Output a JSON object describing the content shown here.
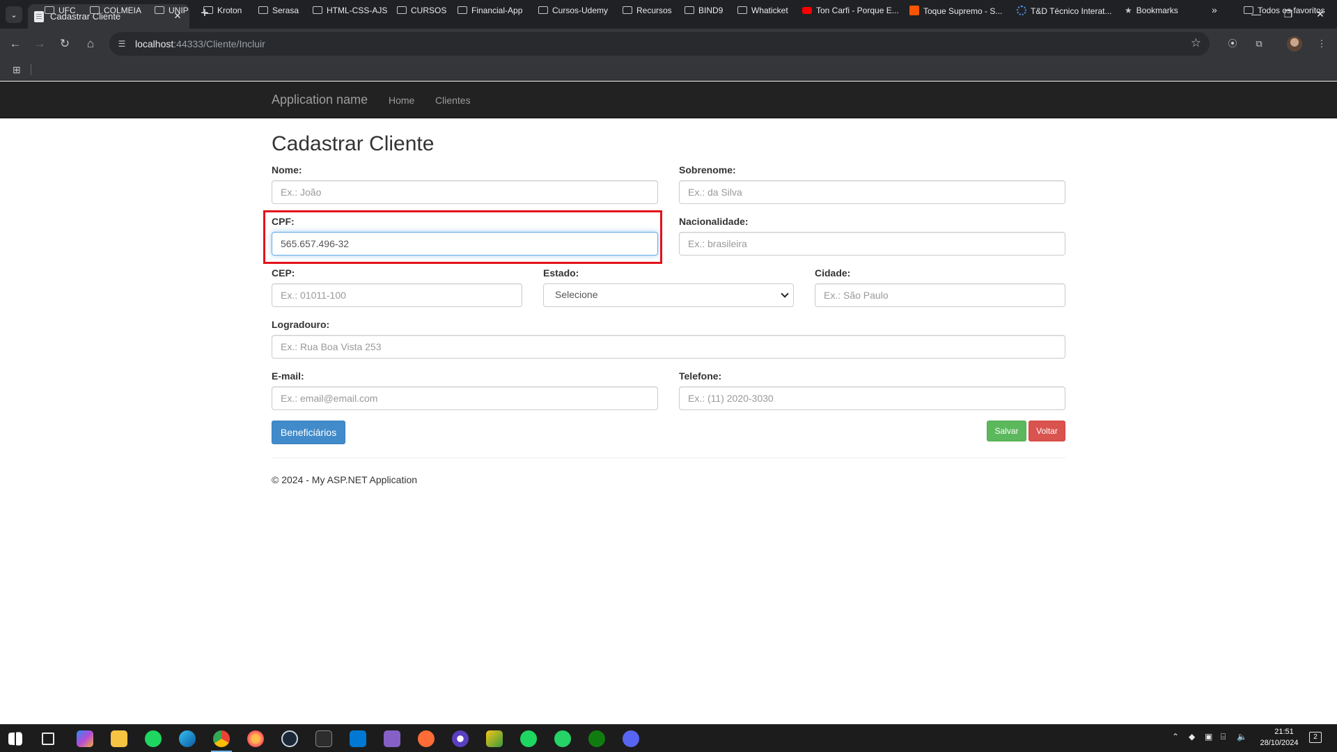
{
  "browser": {
    "tab_title": "Cadastrar Cliente",
    "url_host": "localhost",
    "url_rest": ":44333/Cliente/Incluir",
    "bookmarks": [
      "UFC",
      "COLMEIA",
      "UNIP",
      "Kroton",
      "Serasa",
      "HTML-CSS-AJS",
      "CURSOS",
      "Financial-App",
      "Cursos-Udemy",
      "Recursos",
      "BIND9",
      "Whaticket",
      "Ton Carfi - Porque E...",
      "Toque Supremo - S...",
      "T&D Técnico Interat...",
      "Bookmarks"
    ],
    "more_bookmarks": "»",
    "all_favorites": "Todos os favoritos"
  },
  "navbar": {
    "brand": "Application name",
    "links": [
      "Home",
      "Clientes"
    ]
  },
  "page": {
    "title": "Cadastrar Cliente"
  },
  "form": {
    "nome": {
      "label": "Nome:",
      "placeholder": "Ex.: João",
      "value": ""
    },
    "sobrenome": {
      "label": "Sobrenome:",
      "placeholder": "Ex.: da Silva",
      "value": ""
    },
    "cpf": {
      "label": "CPF:",
      "placeholder": "",
      "value": "565.657.496-32"
    },
    "nacionalidade": {
      "label": "Nacionalidade:",
      "placeholder": "Ex.: brasileira",
      "value": ""
    },
    "cep": {
      "label": "CEP:",
      "placeholder": "Ex.: 01011-100",
      "value": ""
    },
    "estado": {
      "label": "Estado:",
      "selected": "Selecione"
    },
    "cidade": {
      "label": "Cidade:",
      "placeholder": "Ex.: São Paulo",
      "value": ""
    },
    "logradouro": {
      "label": "Logradouro:",
      "placeholder": "Ex.: Rua Boa Vista 253",
      "value": ""
    },
    "email": {
      "label": "E-mail:",
      "placeholder": "Ex.: email@email.com",
      "value": ""
    },
    "telefone": {
      "label": "Telefone:",
      "placeholder": "Ex.: (11) 2020-3030",
      "value": ""
    }
  },
  "buttons": {
    "beneficiarios": "Beneficiários",
    "salvar": "Salvar",
    "voltar": "Voltar"
  },
  "footer": {
    "text": "© 2024 - My ASP.NET Application"
  },
  "taskbar": {
    "time": "21:51",
    "date": "28/10/2024",
    "notifications": "2"
  },
  "colors": {
    "navbar_bg": "#222222",
    "primary": "#428bca",
    "success": "#5cb85c",
    "danger": "#d9534f",
    "highlight": "#e3111b"
  }
}
